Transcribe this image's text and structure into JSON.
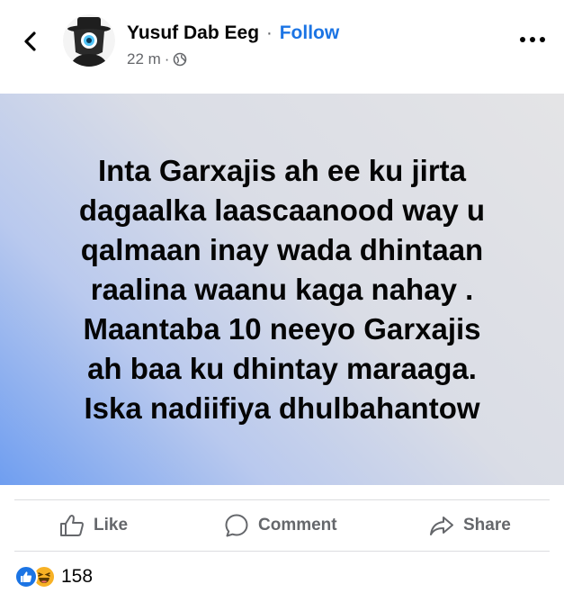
{
  "header": {
    "author_name": "Yusuf Dab Eeg",
    "separator": "·",
    "follow_label": "Follow",
    "timestamp": "22 m",
    "meta_separator": "·",
    "icons": {
      "back": "chevron-left-icon",
      "avatar": "hooded-eye-avatar",
      "privacy": "globe-icon",
      "more": "more-dots-icon"
    }
  },
  "post": {
    "lines": [
      "Inta Garxajis ah ee ku jirta",
      "dagaalka laascaanood way u",
      "qalmaan inay wada dhintaan",
      "raalina waanu kaga nahay .",
      "Maantaba 10 neeyo Garxajis",
      "ah baa ku dhintay maraaga.",
      "Iska nadiifiya dhulbahantow"
    ],
    "background_gradient": [
      "#6f9ef0",
      "#dadde6",
      "#e4e4e6"
    ]
  },
  "actions": {
    "like_label": "Like",
    "comment_label": "Comment",
    "share_label": "Share"
  },
  "reactions": {
    "types": [
      "like",
      "haha"
    ],
    "count": "158",
    "colors": {
      "like": "#1b74e4",
      "haha": "#f7b125"
    }
  },
  "colors": {
    "accent": "#1b74e4",
    "secondary_text": "#65676b",
    "primary_text": "#050505"
  }
}
